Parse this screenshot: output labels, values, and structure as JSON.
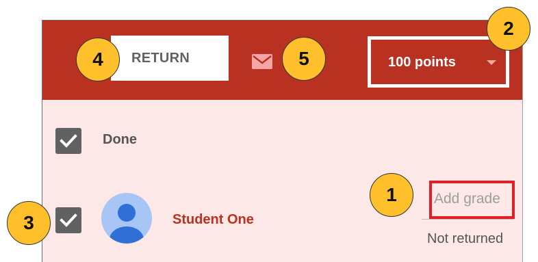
{
  "toolbar": {
    "return_label": "RETURN",
    "points_label": "100 points"
  },
  "list": {
    "select_all_label": "Done",
    "students": [
      {
        "name": "Student One",
        "grade_placeholder": "Add grade",
        "status": "Not returned"
      }
    ]
  },
  "callouts": [
    "1",
    "2",
    "3",
    "4",
    "5"
  ],
  "icons": {
    "mail": "mail-icon",
    "check": "check-icon",
    "dropdown": "dropdown-arrow-icon",
    "avatar": "person-icon"
  },
  "colors": {
    "toolbar": "#b93221",
    "panel_background": "#fce8e6",
    "student_name": "#b93221",
    "callout": "#ffc02b",
    "highlight_white": "#ffffff",
    "highlight_red": "#e02028",
    "checkbox": "#616161",
    "avatar_background": "#a7c6f5",
    "avatar_figure": "#2f6fd6"
  }
}
